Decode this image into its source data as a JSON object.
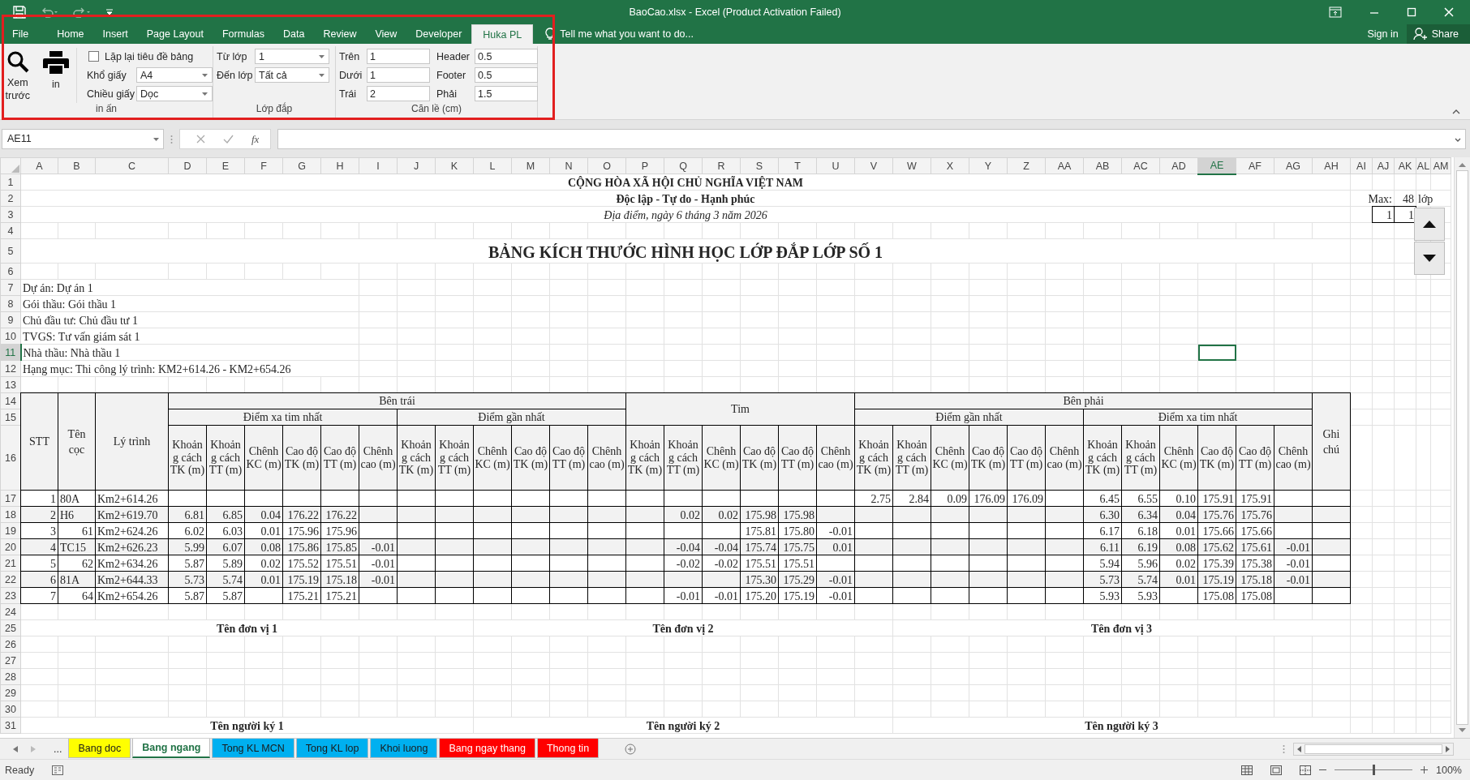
{
  "window": {
    "title": "BaoCao.xlsx - Excel (Product Activation Failed)"
  },
  "ribbon_tabs": [
    {
      "label": "File",
      "selected": false
    },
    {
      "label": "Home",
      "selected": false
    },
    {
      "label": "Insert",
      "selected": false
    },
    {
      "label": "Page Layout",
      "selected": false
    },
    {
      "label": "Formulas",
      "selected": false
    },
    {
      "label": "Data",
      "selected": false
    },
    {
      "label": "Review",
      "selected": false
    },
    {
      "label": "View",
      "selected": false
    },
    {
      "label": "Developer",
      "selected": false
    },
    {
      "label": "Huka PL",
      "selected": true
    }
  ],
  "tell_me": "Tell me what you want to do...",
  "sign_in": "Sign in",
  "share": "Share",
  "ribbon_highlighted": true,
  "ribbon": {
    "print": {
      "label": "in ấn",
      "preview": "Xem trước",
      "print": "in",
      "repeat_header": {
        "label": "Lặp lại tiêu đề bảng",
        "checked": false
      },
      "paper_size": {
        "label": "Khổ giấy",
        "value": "A4"
      },
      "orientation": {
        "label": "Chiều giấy",
        "value": "Dọc"
      }
    },
    "layers": {
      "label": "Lớp đắp",
      "from": {
        "label": "Từ lớp",
        "value": "1"
      },
      "to": {
        "label": "Đến lớp",
        "value": "Tất cả"
      }
    },
    "margins": {
      "label": "Căn lề (cm)",
      "fields": [
        {
          "label": "Trên",
          "value": "1"
        },
        {
          "label": "Dưới",
          "value": "1"
        },
        {
          "label": "Trái",
          "value": "2"
        },
        {
          "label": "Header",
          "value": "0.5"
        },
        {
          "label": "Footer",
          "value": "0.5"
        },
        {
          "label": "Phải",
          "value": "1.5"
        }
      ]
    }
  },
  "formula_bar": {
    "name_box": "AE11",
    "function_label": "fx"
  },
  "sheet": {
    "columns": [
      {
        "label": "A",
        "selected": false
      },
      {
        "label": "B",
        "selected": false
      },
      {
        "label": "C",
        "selected": false
      },
      {
        "label": "D",
        "selected": false
      },
      {
        "label": "E",
        "selected": false
      },
      {
        "label": "F",
        "selected": false
      },
      {
        "label": "G",
        "selected": false
      },
      {
        "label": "H",
        "selected": false
      },
      {
        "label": "I",
        "selected": false
      },
      {
        "label": "J",
        "selected": false
      },
      {
        "label": "K",
        "selected": false
      },
      {
        "label": "L",
        "selected": false
      },
      {
        "label": "M",
        "selected": false
      },
      {
        "label": "N",
        "selected": false
      },
      {
        "label": "O",
        "selected": false
      },
      {
        "label": "P",
        "selected": false
      },
      {
        "label": "Q",
        "selected": false
      },
      {
        "label": "R",
        "selected": false
      },
      {
        "label": "S",
        "selected": false
      },
      {
        "label": "T",
        "selected": false
      },
      {
        "label": "U",
        "selected": false
      },
      {
        "label": "V",
        "selected": false
      },
      {
        "label": "W",
        "selected": false
      },
      {
        "label": "X",
        "selected": false
      },
      {
        "label": "Y",
        "selected": false
      },
      {
        "label": "Z",
        "selected": false
      },
      {
        "label": "AA",
        "selected": false
      },
      {
        "label": "AB",
        "selected": false
      },
      {
        "label": "AC",
        "selected": false
      },
      {
        "label": "AD",
        "selected": false
      },
      {
        "label": "AE",
        "selected": true
      },
      {
        "label": "AF",
        "selected": false
      },
      {
        "label": "AG",
        "selected": false
      },
      {
        "label": "AH",
        "selected": false
      },
      {
        "label": "AI",
        "selected": false
      },
      {
        "label": "AJ",
        "selected": false
      },
      {
        "label": "AK",
        "selected": false
      },
      {
        "label": "AL",
        "selected": false
      },
      {
        "label": "AM",
        "selected": false
      }
    ],
    "rows": [
      {
        "label": "1",
        "selected": false
      },
      {
        "label": "2",
        "selected": false
      },
      {
        "label": "3",
        "selected": false
      },
      {
        "label": "4",
        "selected": false
      },
      {
        "label": "5",
        "selected": false
      },
      {
        "label": "6",
        "selected": false
      },
      {
        "label": "7",
        "selected": false
      },
      {
        "label": "8",
        "selected": false
      },
      {
        "label": "9",
        "selected": false
      },
      {
        "label": "10",
        "selected": false
      },
      {
        "label": "11",
        "selected": true
      },
      {
        "label": "12",
        "selected": false
      },
      {
        "label": "13",
        "selected": false
      },
      {
        "label": "14",
        "selected": false
      },
      {
        "label": "15",
        "selected": false
      },
      {
        "label": "16",
        "selected": false
      },
      {
        "label": "17",
        "selected": false
      },
      {
        "label": "18",
        "selected": false
      },
      {
        "label": "19",
        "selected": false
      },
      {
        "label": "20",
        "selected": false
      },
      {
        "label": "21",
        "selected": false
      },
      {
        "label": "22",
        "selected": false
      },
      {
        "label": "23",
        "selected": false
      },
      {
        "label": "24",
        "selected": false
      },
      {
        "label": "25",
        "selected": false
      },
      {
        "label": "26",
        "selected": false
      },
      {
        "label": "27",
        "selected": false
      },
      {
        "label": "28",
        "selected": false
      },
      {
        "label": "29",
        "selected": false
      },
      {
        "label": "30",
        "selected": false
      },
      {
        "label": "31",
        "selected": false
      }
    ],
    "heading": {
      "nation": "CỘNG HÒA XÃ HỘI CHỦ NGHĨA VIỆT NAM",
      "motto": "Độc lập - Tự do - Hạnh phúc",
      "place_date": "Địa điểm, ngày 6 tháng 3 năm 2026"
    },
    "max": {
      "label": "Max:",
      "value": "48",
      "unit": "lớp"
    },
    "layer_boxes": [
      "1",
      "1"
    ],
    "title": "BẢNG KÍCH THƯỚC HÌNH HỌC LỚP ĐẮP LỚP SỐ 1",
    "info": [
      "Dự án: Dự án 1",
      "Gói thầu: Gói thầu 1",
      "Chủ đầu tư: Chủ đầu tư 1",
      "TVGS: Tư vấn giám sát 1",
      "Nhà thầu: Nhà thầu 1",
      "Hạng mục: Thi công lý trình: KM2+614.26 - KM2+654.26"
    ],
    "table": {
      "headers": {
        "stt": "STT",
        "pile": "Tên cọc",
        "station": "Lý trình",
        "note": "Ghi chú"
      },
      "sections": [
        {
          "label": "Bên trái",
          "groups": [
            {
              "label": "Điểm xa tim nhất",
              "columns": [
                "Khoảng cách TK (m)",
                "Khoảng cách TT (m)",
                "Chênh KC (m)",
                "Cao độ TK (m)",
                "Cao độ TT (m)",
                "Chênh cao (m)"
              ]
            },
            {
              "label": "Điểm gần nhất",
              "columns": [
                "Khoảng cách TK (m)",
                "Khoảng cách TT (m)",
                "Chênh KC (m)",
                "Cao độ TK (m)",
                "Cao độ TT (m)",
                "Chênh cao (m)"
              ]
            }
          ]
        },
        {
          "label": "Tim",
          "groups": [
            {
              "columns": [
                "Khoảng cách TK (m)",
                "Khoảng cách TT (m)",
                "Chênh KC (m)",
                "Cao độ TK (m)",
                "Cao độ TT (m)",
                "Chênh cao (m)"
              ]
            }
          ]
        },
        {
          "label": "Bên phải",
          "groups": [
            {
              "label": "Điểm gần nhất",
              "columns": [
                "Khoảng cách TK (m)",
                "Khoảng cách TT (m)",
                "Chênh KC (m)",
                "Cao độ TK (m)",
                "Cao độ TT (m)",
                "Chênh cao (m)"
              ]
            },
            {
              "label": "Điểm xa tim nhất",
              "columns": [
                "Khoảng cách TK (m)",
                "Khoảng cách TT (m)",
                "Chênh KC (m)",
                "Cao độ TK (m)",
                "Cao độ TT (m)",
                "Chênh cao (m)"
              ]
            }
          ]
        }
      ],
      "rows": [
        {
          "stt": "1",
          "pile": "80A",
          "pile_is_number": false,
          "station": "Km2+614.26",
          "shaded": false,
          "right_near": {
            "dist_tk": "2.75",
            "dist_tt": "2.84",
            "dist_diff": "0.09",
            "elev_tk": "176.09",
            "elev_tt": "176.09"
          },
          "right_far": {
            "dist_tk": "6.45",
            "dist_tt": "6.55",
            "dist_diff": "0.10",
            "elev_tk": "175.91",
            "elev_tt": "175.91"
          }
        },
        {
          "stt": "2",
          "pile": "H6",
          "pile_is_number": false,
          "station": "Km2+619.70",
          "shaded": true,
          "left_far": {
            "dist_tk": "6.81",
            "dist_tt": "6.85",
            "dist_diff": "0.04",
            "elev_tk": "176.22",
            "elev_tt": "176.22"
          },
          "center": {
            "dist_tt": "0.02",
            "dist_diff": "0.02",
            "elev_tk": "175.98",
            "elev_tt": "175.98"
          },
          "right_far": {
            "dist_tk": "6.30",
            "dist_tt": "6.34",
            "dist_diff": "0.04",
            "elev_tk": "175.76",
            "elev_tt": "175.76"
          }
        },
        {
          "stt": "3",
          "pile": "61",
          "pile_is_number": true,
          "station": "Km2+624.26",
          "shaded": false,
          "left_far": {
            "dist_tk": "6.02",
            "dist_tt": "6.03",
            "dist_diff": "0.01",
            "elev_tk": "175.96",
            "elev_tt": "175.96"
          },
          "center": {
            "elev_tk": "175.81",
            "elev_tt": "175.80",
            "elev_diff": "-0.01"
          },
          "right_far": {
            "dist_tk": "6.17",
            "dist_tt": "6.18",
            "dist_diff": "0.01",
            "elev_tk": "175.66",
            "elev_tt": "175.66"
          }
        },
        {
          "stt": "4",
          "pile": "TC15",
          "pile_is_number": false,
          "station": "Km2+626.23",
          "shaded": true,
          "left_far": {
            "dist_tk": "5.99",
            "dist_tt": "6.07",
            "dist_diff": "0.08",
            "elev_tk": "175.86",
            "elev_tt": "175.85",
            "elev_diff": "-0.01"
          },
          "center": {
            "dist_tt": "-0.04",
            "dist_diff": "-0.04",
            "elev_tk": "175.74",
            "elev_tt": "175.75",
            "elev_diff": "0.01"
          },
          "right_far": {
            "dist_tk": "6.11",
            "dist_tt": "6.19",
            "dist_diff": "0.08",
            "elev_tk": "175.62",
            "elev_tt": "175.61",
            "elev_diff": "-0.01"
          }
        },
        {
          "stt": "5",
          "pile": "62",
          "pile_is_number": true,
          "station": "Km2+634.26",
          "shaded": false,
          "left_far": {
            "dist_tk": "5.87",
            "dist_tt": "5.89",
            "dist_diff": "0.02",
            "elev_tk": "175.52",
            "elev_tt": "175.51",
            "elev_diff": "-0.01"
          },
          "center": {
            "dist_tt": "-0.02",
            "dist_diff": "-0.02",
            "elev_tk": "175.51",
            "elev_tt": "175.51"
          },
          "right_far": {
            "dist_tk": "5.94",
            "dist_tt": "5.96",
            "dist_diff": "0.02",
            "elev_tk": "175.39",
            "elev_tt": "175.38",
            "elev_diff": "-0.01"
          }
        },
        {
          "stt": "6",
          "pile": "81A",
          "pile_is_number": false,
          "station": "Km2+644.33",
          "shaded": true,
          "left_far": {
            "dist_tk": "5.73",
            "dist_tt": "5.74",
            "dist_diff": "0.01",
            "elev_tk": "175.19",
            "elev_tt": "175.18",
            "elev_diff": "-0.01"
          },
          "center": {
            "elev_tk": "175.30",
            "elev_tt": "175.29",
            "elev_diff": "-0.01"
          },
          "right_far": {
            "dist_tk": "5.73",
            "dist_tt": "5.74",
            "dist_diff": "0.01",
            "elev_tk": "175.19",
            "elev_tt": "175.18",
            "elev_diff": "-0.01"
          }
        },
        {
          "stt": "7",
          "pile": "64",
          "pile_is_number": true,
          "station": "Km2+654.26",
          "shaded": false,
          "left_far": {
            "dist_tk": "5.87",
            "dist_tt": "5.87",
            "elev_tk": "175.21",
            "elev_tt": "175.21"
          },
          "center": {
            "dist_tt": "-0.01",
            "dist_diff": "-0.01",
            "elev_tk": "175.20",
            "elev_tt": "175.19",
            "elev_diff": "-0.01"
          },
          "right_far": {
            "dist_tk": "5.93",
            "dist_tt": "5.93",
            "elev_tk": "175.08",
            "elev_tt": "175.08"
          }
        }
      ]
    },
    "units": [
      "Tên đơn vị 1",
      "Tên đơn vị 2",
      "Tên đơn vị 3"
    ],
    "signers": [
      "Tên người ký 1",
      "Tên người ký 2",
      "Tên người ký 3"
    ]
  },
  "sheet_tabs_more": "...",
  "sheet_tabs": [
    {
      "label": "Bang doc",
      "color": "#ffff00",
      "selected": false
    },
    {
      "label": "Bang ngang",
      "selected": true
    },
    {
      "label": "Tong KL MCN",
      "color": "#00b0f0",
      "selected": false
    },
    {
      "label": "Tong KL lop",
      "color": "#00b0f0",
      "selected": false
    },
    {
      "label": "Khoi luong",
      "color": "#00b0f0",
      "selected": false
    },
    {
      "label": "Bang ngay thang",
      "color": "#ff0000",
      "selected": false
    },
    {
      "label": "Thong tin",
      "color": "#ff0000",
      "selected": false
    }
  ],
  "status_bar": {
    "status": "Ready",
    "zoom": {
      "level": 0.5,
      "reading": "100%"
    }
  }
}
